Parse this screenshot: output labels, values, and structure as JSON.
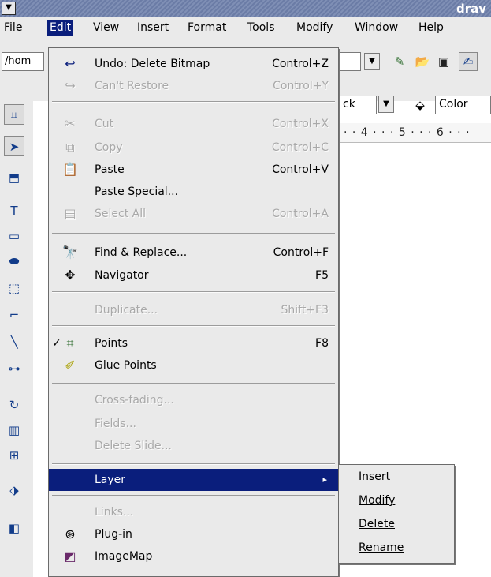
{
  "window": {
    "title": "drav"
  },
  "menubar": {
    "items": [
      {
        "label": "File"
      },
      {
        "label": "Edit"
      },
      {
        "label": "View"
      },
      {
        "label": "Insert"
      },
      {
        "label": "Format"
      },
      {
        "label": "Tools"
      },
      {
        "label": "Modify"
      },
      {
        "label": "Window"
      },
      {
        "label": "Help"
      }
    ],
    "active": "Edit"
  },
  "toolbar": {
    "path_value": "/hom",
    "line_style_value": "ck",
    "fill_label": "Color",
    "ruler_text": "· · 4 · · · 5 · · · 6 · · ·"
  },
  "edit_menu": {
    "undo": {
      "label": "Undo: Delete Bitmap",
      "shortcut": "Control+Z"
    },
    "restore": {
      "label": "Can't Restore",
      "shortcut": "Control+Y"
    },
    "cut": {
      "label": "Cut",
      "shortcut": "Control+X"
    },
    "copy": {
      "label": "Copy",
      "shortcut": "Control+C"
    },
    "paste": {
      "label": "Paste",
      "shortcut": "Control+V"
    },
    "paste_special": {
      "label": "Paste Special..."
    },
    "select_all": {
      "label": "Select All",
      "shortcut": "Control+A"
    },
    "find_replace": {
      "label": "Find & Replace...",
      "shortcut": "Control+F"
    },
    "navigator": {
      "label": "Navigator",
      "shortcut": "F5"
    },
    "duplicate": {
      "label": "Duplicate...",
      "shortcut": "Shift+F3"
    },
    "points": {
      "label": "Points",
      "shortcut": "F8",
      "checked": true
    },
    "glue_points": {
      "label": "Glue Points"
    },
    "cross_fading": {
      "label": "Cross-fading..."
    },
    "fields": {
      "label": "Fields..."
    },
    "delete_slide": {
      "label": "Delete Slide..."
    },
    "layer": {
      "label": "Layer"
    },
    "links": {
      "label": "Links..."
    },
    "plugin": {
      "label": "Plug-in"
    },
    "imagemap": {
      "label": "ImageMap"
    }
  },
  "layer_submenu": {
    "items": [
      {
        "label": "Insert"
      },
      {
        "label": "Modify"
      },
      {
        "label": "Delete"
      },
      {
        "label": "Rename"
      }
    ]
  },
  "colors": {
    "highlight": "#0a1e7c",
    "menu_bg": "#eaeaea"
  }
}
